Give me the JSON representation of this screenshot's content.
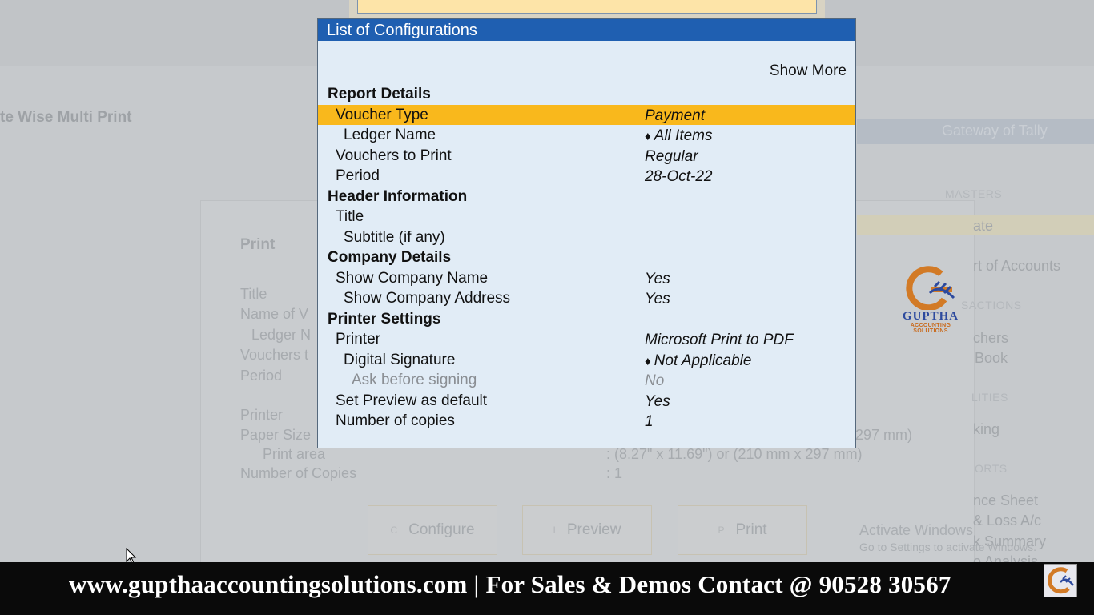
{
  "background": {
    "page_title": "te Wise Multi Print",
    "gateway": "Gateway of Tally",
    "print_panel": {
      "title": "Print",
      "labels": [
        "Title",
        "Name of V",
        "Ledger N",
        "Vouchers t",
        "Period",
        "Printer",
        "Paper Size",
        "Print area",
        "Number of Copies"
      ],
      "values": [
        "297 mm)",
        ": (8.27\" x 11.69\") or (210 mm x 297 mm)",
        ": 1"
      ],
      "buttons": [
        {
          "key": "C",
          "label": "Configure"
        },
        {
          "key": "I",
          "label": "Preview"
        },
        {
          "key": "P",
          "label": "Print"
        }
      ]
    },
    "right_menu": {
      "heading_masters": "MASTERS",
      "item_create": "ate",
      "item_chart": "rt of Accounts",
      "heading_transactions": "SACTIONS",
      "item_vouchers": "chers",
      "item_daybook": "Book",
      "heading_utilities": "LITIES",
      "item_banking": "king",
      "heading_reports": "ORTS",
      "item_balance": "nce Sheet",
      "item_pl": "& Loss A/c",
      "item_stock": "k Summary",
      "item_ratio": "o Analysis"
    },
    "activate": {
      "line1": "Activate Windows",
      "line2": "Go to Settings to activate Windows."
    }
  },
  "dialog": {
    "title": "List of Configurations",
    "show_more": "Show More",
    "rows": [
      {
        "type": "section",
        "label": "Report Details"
      },
      {
        "type": "l1",
        "label": "Voucher Type",
        "value": "Payment",
        "highlight": true
      },
      {
        "type": "l2",
        "label": "Ledger Name",
        "value": "All Items",
        "diamond": true
      },
      {
        "type": "l1",
        "label": "Vouchers to Print",
        "value": "Regular"
      },
      {
        "type": "l1",
        "label": "Period",
        "value": "28-Oct-22"
      },
      {
        "type": "section",
        "label": "Header Information"
      },
      {
        "type": "l1",
        "label": "Title",
        "value": ""
      },
      {
        "type": "l2",
        "label": "Subtitle (if any)",
        "value": ""
      },
      {
        "type": "section",
        "label": "Company Details"
      },
      {
        "type": "l1",
        "label": "Show Company Name",
        "value": "Yes"
      },
      {
        "type": "l2",
        "label": "Show Company Address",
        "value": "Yes"
      },
      {
        "type": "section",
        "label": "Printer Settings"
      },
      {
        "type": "l1",
        "label": "Printer",
        "value": "Microsoft Print to PDF"
      },
      {
        "type": "l2",
        "label": "Digital Signature",
        "value": "Not Applicable",
        "diamond": true
      },
      {
        "type": "l3",
        "label": "Ask before signing",
        "value": "No",
        "muted": true
      },
      {
        "type": "l1",
        "label": "Set Preview as default",
        "value": "Yes"
      },
      {
        "type": "l1",
        "label": "Number of copies",
        "value": "1"
      }
    ]
  },
  "logo": {
    "name": "GUPTHA",
    "tagline": "ACCOUNTING SOLUTIONS"
  },
  "footer": {
    "text": "www.gupthaaccountingsolutions.com | For Sales & Demos Contact @ 90528 30567"
  },
  "colors": {
    "title_bar": "#1f5fb1",
    "highlight": "#f9b81c",
    "dialog_bg": "#e1ecf6",
    "footer_bg": "#0a0a0a"
  }
}
